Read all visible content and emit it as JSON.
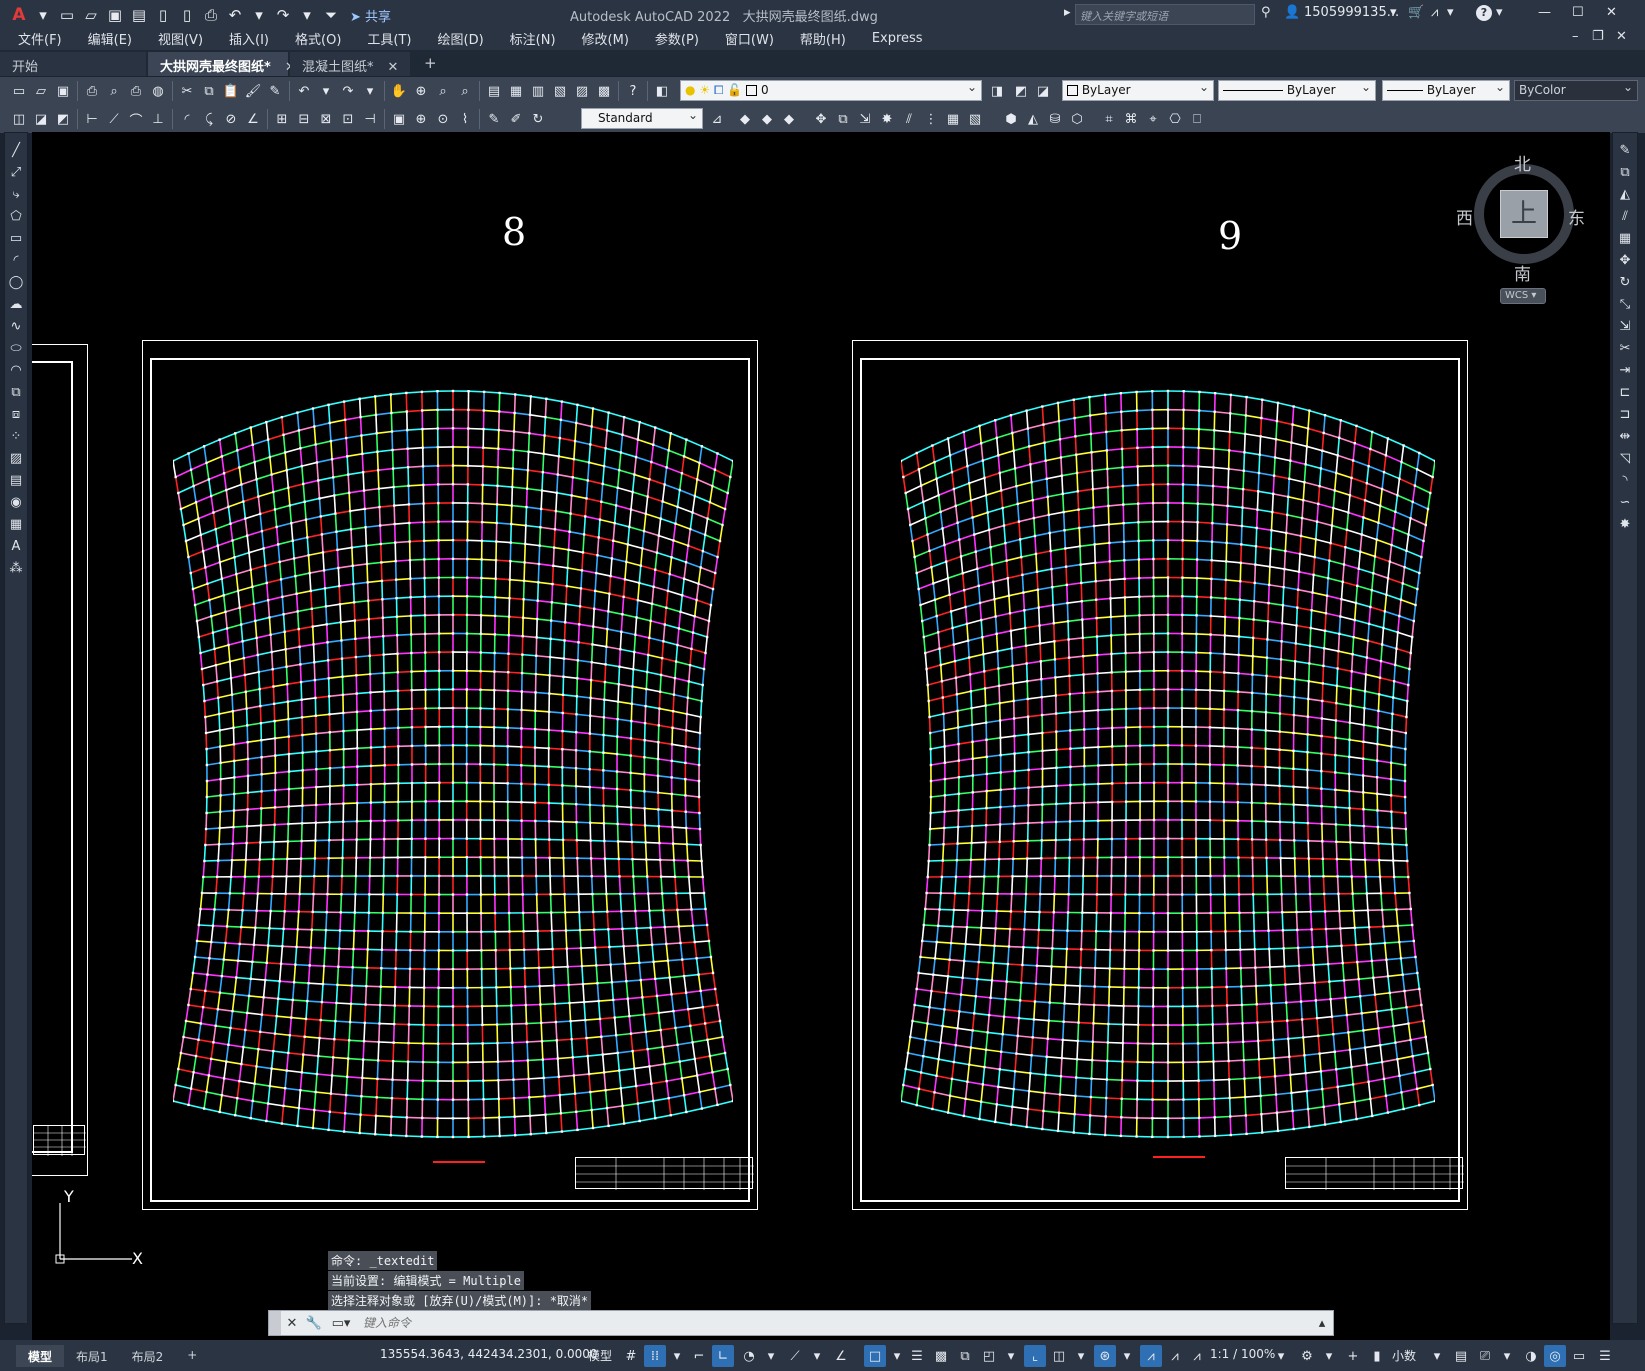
{
  "titlebar": {
    "app_title": "Autodesk AutoCAD 2022",
    "file_title": "大拱网壳最终图纸.dwg",
    "share_label": "共享",
    "search_placeholder": "键入关键字或短语",
    "user": "1505999135...",
    "help": "?"
  },
  "menu": [
    "文件(F)",
    "编辑(E)",
    "视图(V)",
    "插入(I)",
    "格式(O)",
    "工具(T)",
    "绘图(D)",
    "标注(N)",
    "修改(M)",
    "参数(P)",
    "窗口(W)",
    "帮助(H)",
    "Express"
  ],
  "tabs": {
    "start": "开始",
    "items": [
      {
        "label": "大拱网壳最终图纸*",
        "active": true
      },
      {
        "label": "混凝土图纸*",
        "active": false
      }
    ],
    "add": "+"
  },
  "toolbar": {
    "layer": "0",
    "color": "ByLayer",
    "linetype": "ByLayer",
    "lineweight": "ByLayer",
    "plotstyle": "ByColor",
    "textstyle": "Standard"
  },
  "drawing": {
    "sheet_numbers": [
      "8",
      "9"
    ],
    "grid_colors": [
      "#ffff33",
      "#33aaff",
      "#ff2222",
      "#33ff66",
      "#ff88cc",
      "#33ffff",
      "#ffffff",
      "#ff33ff",
      "#2255ff"
    ]
  },
  "viewcube": {
    "face": "上",
    "north": "北",
    "south": "南",
    "east": "东",
    "west": "西",
    "wcs": "WCS"
  },
  "ucs": {
    "x": "X",
    "y": "Y"
  },
  "command": {
    "history": [
      "命令: _textedit",
      "当前设置: 编辑模式 = Multiple",
      "选择注释对象或 [放弃(U)/模式(M)]: *取消*"
    ],
    "placeholder": "键入命令"
  },
  "status": {
    "layouts": [
      "模型",
      "布局1",
      "布局2"
    ],
    "add": "+",
    "coords": "135554.3643, 442434.2301, 0.0000",
    "space": "模型",
    "scale": "1:1 / 100%",
    "units": "小数"
  }
}
